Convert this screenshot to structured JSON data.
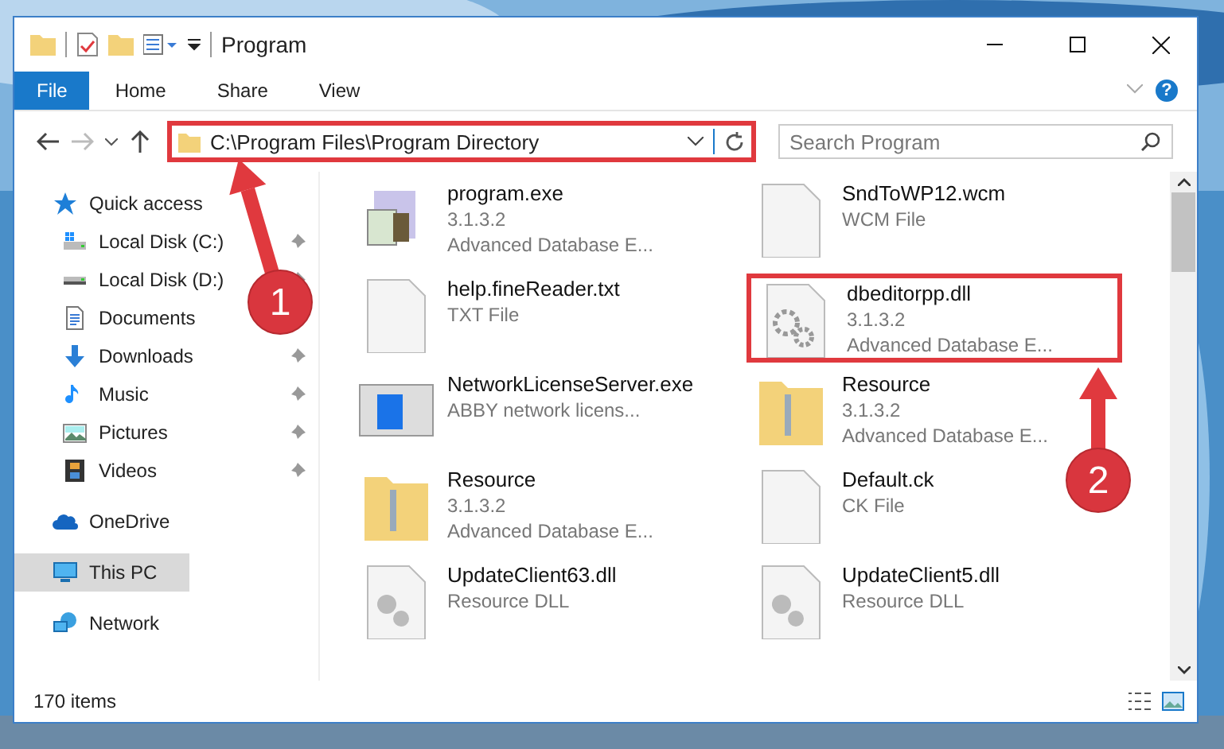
{
  "window": {
    "title": "Program"
  },
  "ribbon": {
    "tabs": [
      {
        "label": "File",
        "selected": true
      },
      {
        "label": "Home",
        "selected": false
      },
      {
        "label": "Share",
        "selected": false
      },
      {
        "label": "View",
        "selected": false
      }
    ],
    "help_label": "?"
  },
  "address": {
    "path": "C:\\Program Files\\Program Directory",
    "highlighted": true
  },
  "search": {
    "placeholder": "Search Program"
  },
  "nav": {
    "items": [
      {
        "label": "Quick access",
        "kind": "star",
        "selected": false,
        "children": [
          {
            "label": "Local Disk (C:)",
            "kind": "system-drive",
            "pinned": true,
            "selected": false
          },
          {
            "label": "Local Disk (D:)",
            "kind": "drive",
            "pinned": true,
            "selected": false
          },
          {
            "label": "Documents",
            "kind": "documents",
            "selected": false
          },
          {
            "label": "Downloads",
            "kind": "downloads",
            "pinned": true,
            "selected": false
          },
          {
            "label": "Music",
            "kind": "music",
            "pinned": true,
            "selected": false
          },
          {
            "label": "Pictures",
            "kind": "pictures",
            "pinned": true,
            "selected": false
          },
          {
            "label": "Videos",
            "kind": "videos",
            "pinned": true,
            "selected": false
          }
        ]
      },
      {
        "label": "OneDrive",
        "kind": "cloud",
        "selected": false
      },
      {
        "label": "This PC",
        "kind": "computer",
        "selected": true
      },
      {
        "label": "Network",
        "kind": "network",
        "selected": false
      }
    ]
  },
  "files": [
    {
      "name": "program.exe",
      "lines": [
        "3.1.3.2",
        "Advanced Database E..."
      ],
      "kind": "exe",
      "highlighted": false
    },
    {
      "name": "SndToWP12.wcm",
      "lines": [
        "WCM File"
      ],
      "kind": "blank",
      "highlighted": false
    },
    {
      "name": "help.fineReader.txt",
      "lines": [
        "TXT File"
      ],
      "kind": "blank",
      "highlighted": false
    },
    {
      "name": "dbeditorpp.dll",
      "lines": [
        "3.1.3.2",
        "Advanced Database E..."
      ],
      "kind": "dll",
      "highlighted": true
    },
    {
      "name": "NetworkLicenseServer.exe",
      "lines": [
        "ABBY network licens..."
      ],
      "kind": "app-window",
      "highlighted": false
    },
    {
      "name": "Resource",
      "lines": [
        "3.1.3.2",
        "Advanced Database E..."
      ],
      "kind": "folder",
      "highlighted": false
    },
    {
      "name": "Resource",
      "lines": [
        "3.1.3.2",
        "Advanced Database E..."
      ],
      "kind": "folder",
      "highlighted": false
    },
    {
      "name": "Default.ck",
      "lines": [
        "CK File"
      ],
      "kind": "blank",
      "highlighted": false
    },
    {
      "name": "UpdateClient63.dll",
      "lines": [
        "Resource DLL"
      ],
      "kind": "resource",
      "highlighted": false
    },
    {
      "name": "UpdateClient5.dll",
      "lines": [
        "Resource DLL"
      ],
      "kind": "resource",
      "highlighted": false
    }
  ],
  "status_bar": {
    "count": "170 items"
  },
  "annotations": [
    {
      "label": "1"
    },
    {
      "label": "2"
    }
  ]
}
